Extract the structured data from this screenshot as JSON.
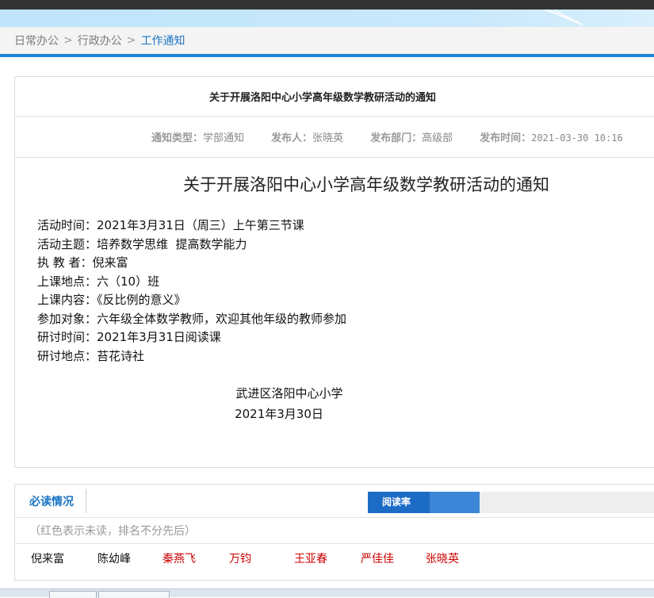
{
  "breadcrumb": {
    "items": [
      "日常办公",
      "行政办公",
      "工作通知"
    ],
    "separator": ">"
  },
  "notice": {
    "header_title": "关于开展洛阳中心小学高年级数学教研活动的通知",
    "meta": {
      "type_label": "通知类型：",
      "type_value": "学部通知",
      "publisher_label": "发布人：",
      "publisher_value": "张晓英",
      "dept_label": "发布部门：",
      "dept_value": "高级部",
      "time_label": "发布时间：",
      "time_value": "2021-03-30 10:16"
    },
    "body_title": "关于开展洛阳中心小学高年级数学教研活动的通知",
    "lines": [
      "活动时间：2021年3月31日（周三）上午第三节课",
      "活动主题：培养数学思维  提高数学能力",
      "执 教 者：倪来富",
      "上课地点：六（10）班",
      "上课内容：《反比例的意义》",
      "参加对象：六年级全体数学教师，欢迎其他年级的教师参加",
      "研讨时间：2021年3月31日阅读课",
      "研讨地点：苔花诗社"
    ],
    "signature": "武进区洛阳中心小学",
    "date": "2021年3月30日"
  },
  "reading": {
    "tab_label": "必读情况",
    "rate_label": "阅读率",
    "rate_fraction": 0.37,
    "note": "（红色表示未读，排名不分先后）",
    "names": [
      {
        "name": "倪来富",
        "read": true
      },
      {
        "name": "陈幼峰",
        "read": true
      },
      {
        "name": "秦燕飞",
        "read": false
      },
      {
        "name": "万钧",
        "read": false
      },
      {
        "name": "王亚春",
        "read": false
      },
      {
        "name": "严佳佳",
        "read": false
      },
      {
        "name": "张晓英",
        "read": false
      }
    ]
  },
  "colors": {
    "accent": "#1e84d4",
    "link": "#1b76c4",
    "unread": "#cc0000",
    "read": "#111111"
  }
}
